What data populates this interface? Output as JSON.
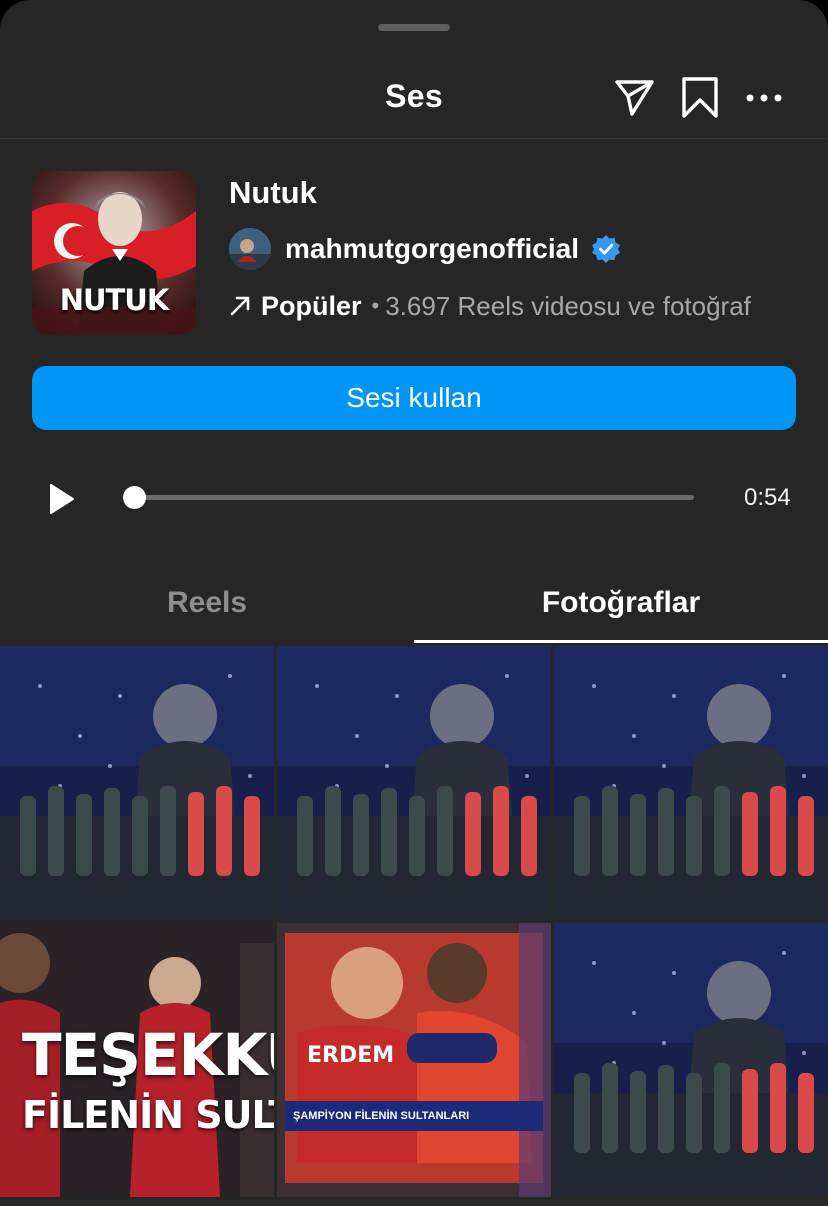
{
  "header": {
    "title": "Ses",
    "icons": [
      "send-icon",
      "bookmark-icon",
      "more-icon"
    ]
  },
  "audio": {
    "cover_text": "NUTUK",
    "title": "Nutuk",
    "artist": "mahmutgorgenofficial",
    "verified": true,
    "popular_label": "Popüler",
    "separator": "•",
    "count_text": "3.697 Reels videosu ve fotoğraf"
  },
  "actions": {
    "use_audio_label": "Sesi kullan"
  },
  "player": {
    "progress": 0,
    "duration": "0:54"
  },
  "tabs": [
    {
      "label": "Reels",
      "active": false
    },
    {
      "label": "Fotoğraflar",
      "active": true
    }
  ],
  "grid": {
    "overlay_line1": "TEŞEKKÜRLER",
    "overlay_line2": "FİLENİN SULTANLARI",
    "tv_player_name": "ERDEM",
    "tv_banner": "ŞAMPİYON FİLENİN SULTANLARI"
  },
  "colors": {
    "background": "#262626",
    "accent": "#0095f6",
    "secondary_text": "#a8a8a8"
  }
}
